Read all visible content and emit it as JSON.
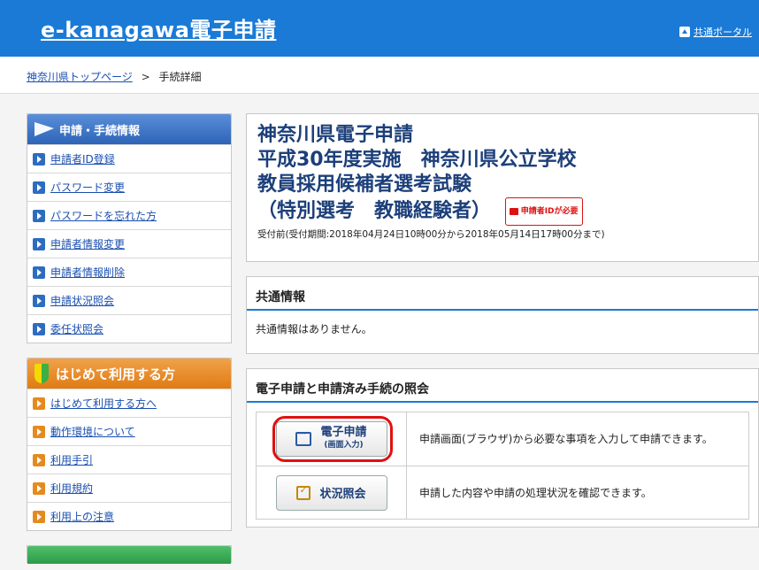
{
  "header": {
    "site_title": "e-kanagawa電子申請",
    "portal_label": "共通ポータル"
  },
  "breadcrumb": {
    "top_link": "神奈川県トップページ",
    "separator": ">",
    "current": "手続詳細"
  },
  "sidebar": {
    "section1": {
      "title": "申請・手続情報",
      "items": [
        {
          "label": "申請者ID登録"
        },
        {
          "label": "パスワード変更"
        },
        {
          "label": "パスワードを忘れた方"
        },
        {
          "label": "申請者情報変更"
        },
        {
          "label": "申請者情報削除"
        },
        {
          "label": "申請状況照会"
        },
        {
          "label": "委任状照会"
        }
      ]
    },
    "section2": {
      "title": "はじめて利用する方",
      "items": [
        {
          "label": "はじめて利用する方へ"
        },
        {
          "label": "動作環境について"
        },
        {
          "label": "利用手引"
        },
        {
          "label": "利用規約"
        },
        {
          "label": "利用上の注意"
        }
      ]
    }
  },
  "main": {
    "title_lines": [
      "神奈川県電子申請",
      "平成30年度実施　神奈川県公立学校",
      "教員採用候補者選考試験",
      "（特別選考　教職経験者）"
    ],
    "id_badge": "申請者IDが必要",
    "period": "受付前(受付期間:2018年04月24日10時00分から2018年05月14日17時00分まで)",
    "common": {
      "heading": "共通情報",
      "body": "共通情報はありません。"
    },
    "apply": {
      "heading": "電子申請と申請済み手続の照会",
      "rows": [
        {
          "button_main": "電子申請",
          "button_sub": "(画面入力)",
          "description": "申請画面(ブラウザ)から必要な事項を入力して申請できます。"
        },
        {
          "button_main": "状況照会",
          "description": "申請した内容や申請の処理状況を確認できます。"
        }
      ]
    }
  },
  "colors": {
    "header_blue": "#1a7ad6",
    "title_navy": "#1c3f7a",
    "highlight_red": "#e01010"
  }
}
